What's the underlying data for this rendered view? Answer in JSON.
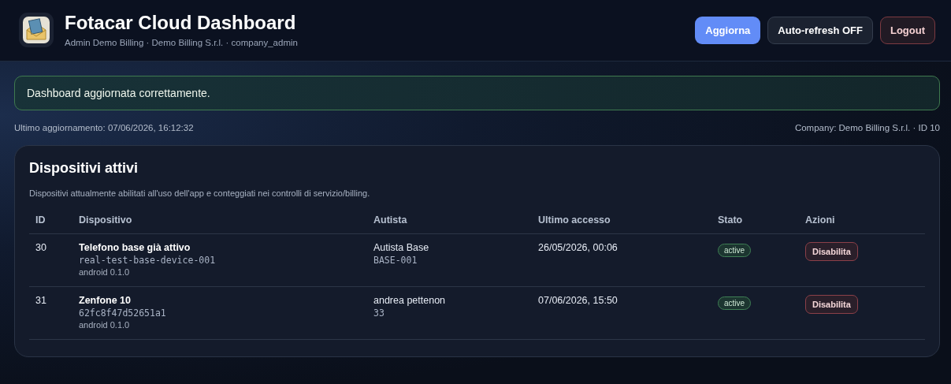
{
  "header": {
    "title": "Fotacar Cloud Dashboard",
    "subtitle": "Admin Demo Billing · Demo Billing S.r.l. · company_admin",
    "buttons": [
      {
        "label": "Aggiorna",
        "kind": "primary"
      },
      {
        "label": "Auto-refresh OFF",
        "kind": "secondary"
      },
      {
        "label": "Logout",
        "kind": "danger"
      }
    ]
  },
  "alert": {
    "kind": "success",
    "text": "Dashboard aggiornata correttamente."
  },
  "meta": {
    "updated": "Ultimo aggiornamento: 07/06/2026, 16:12:32",
    "company": "Company: Demo Billing S.r.l. · ID 10"
  },
  "devices_card": {
    "title": "Dispositivi attivi",
    "description": "Dispositivi attualmente abilitati all'uso dell'app e conteggiati nei controlli di servizio/billing.",
    "columns": [
      "ID",
      "Dispositivo",
      "Autista",
      "Ultimo accesso",
      "Stato",
      "Azioni"
    ],
    "rows": [
      {
        "id": "30",
        "device_name": "Telefono base già attivo",
        "device_code": "real-test-base-device-001",
        "platform": "android 0.1.0",
        "driver_name": "Autista Base",
        "driver_code": "BASE-001",
        "last_access": "26/05/2026, 00:06",
        "status": "active",
        "enabled": true,
        "action": "Disabilita"
      },
      {
        "id": "31",
        "device_name": "Zenfone 10",
        "device_code": "62fc8f47d52651a1",
        "platform": "android 0.1.0",
        "driver_name": "andrea pettenon",
        "driver_code": "33",
        "last_access": "07/06/2026, 15:50",
        "status": "active",
        "enabled": true,
        "action": "Disabilita"
      }
    ]
  }
}
